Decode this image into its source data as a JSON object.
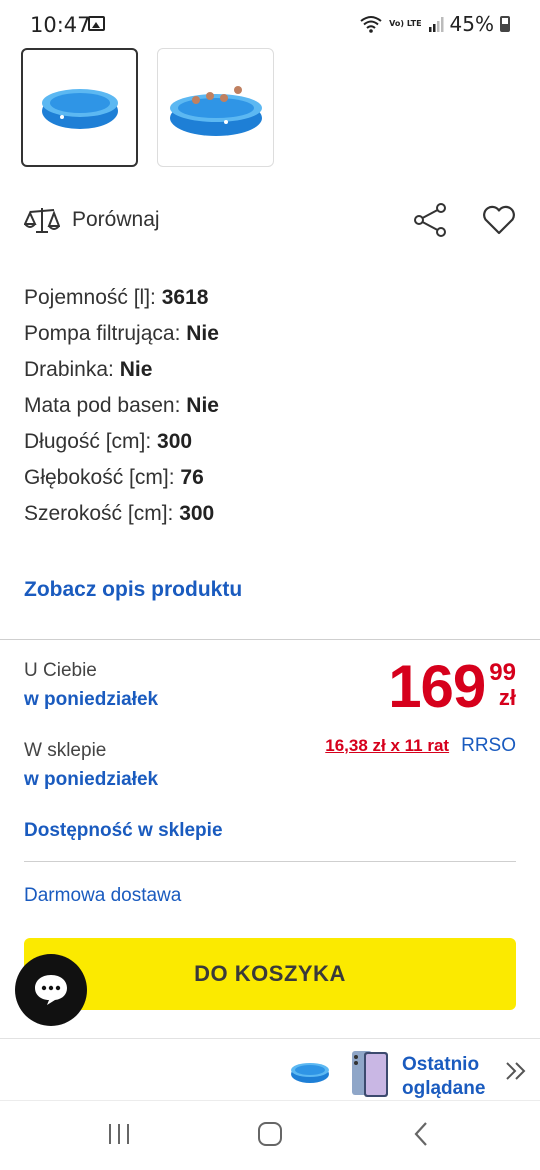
{
  "status_bar": {
    "time": "10:47",
    "network_label": "Vo) LTE",
    "battery_percent": "45%"
  },
  "gallery": {
    "thumbnails": [
      {
        "icon": "pool-icon",
        "selected": true
      },
      {
        "icon": "pool-with-people-icon",
        "selected": false
      }
    ]
  },
  "actions": {
    "compare_label": "Porównaj",
    "share_icon": "share-icon",
    "favorite_icon": "heart-icon"
  },
  "specs": [
    {
      "label": "Pojemność [l]: ",
      "value": "3618"
    },
    {
      "label": "Pompa filtrująca: ",
      "value": "Nie"
    },
    {
      "label": "Drabinka: ",
      "value": "Nie"
    },
    {
      "label": "Mata pod basen: ",
      "value": "Nie"
    },
    {
      "label": "Długość [cm]: ",
      "value": "300"
    },
    {
      "label": "Głębokość [cm]: ",
      "value": "76"
    },
    {
      "label": "Szerokość [cm]: ",
      "value": "300"
    }
  ],
  "description_link": "Zobacz opis produktu",
  "delivery": {
    "home_label": "U Ciebie",
    "home_day": "w poniedziałek",
    "store_label": "W sklepie",
    "store_day": "w poniedziałek",
    "availability_link": "Dostępność w sklepie",
    "free_delivery": "Darmowa dostawa"
  },
  "price": {
    "main": "169",
    "cents": "99",
    "currency": "zł",
    "installment": "16,38 zł x 11 rat",
    "rrso": "RRSO"
  },
  "cart_button": "DO KOSZYKA",
  "recently_viewed": {
    "label": "Ostatnio oglądane"
  },
  "colors": {
    "accent_blue": "#1a5bbf",
    "price_red": "#d6001c",
    "cart_yellow": "#fbea00"
  }
}
